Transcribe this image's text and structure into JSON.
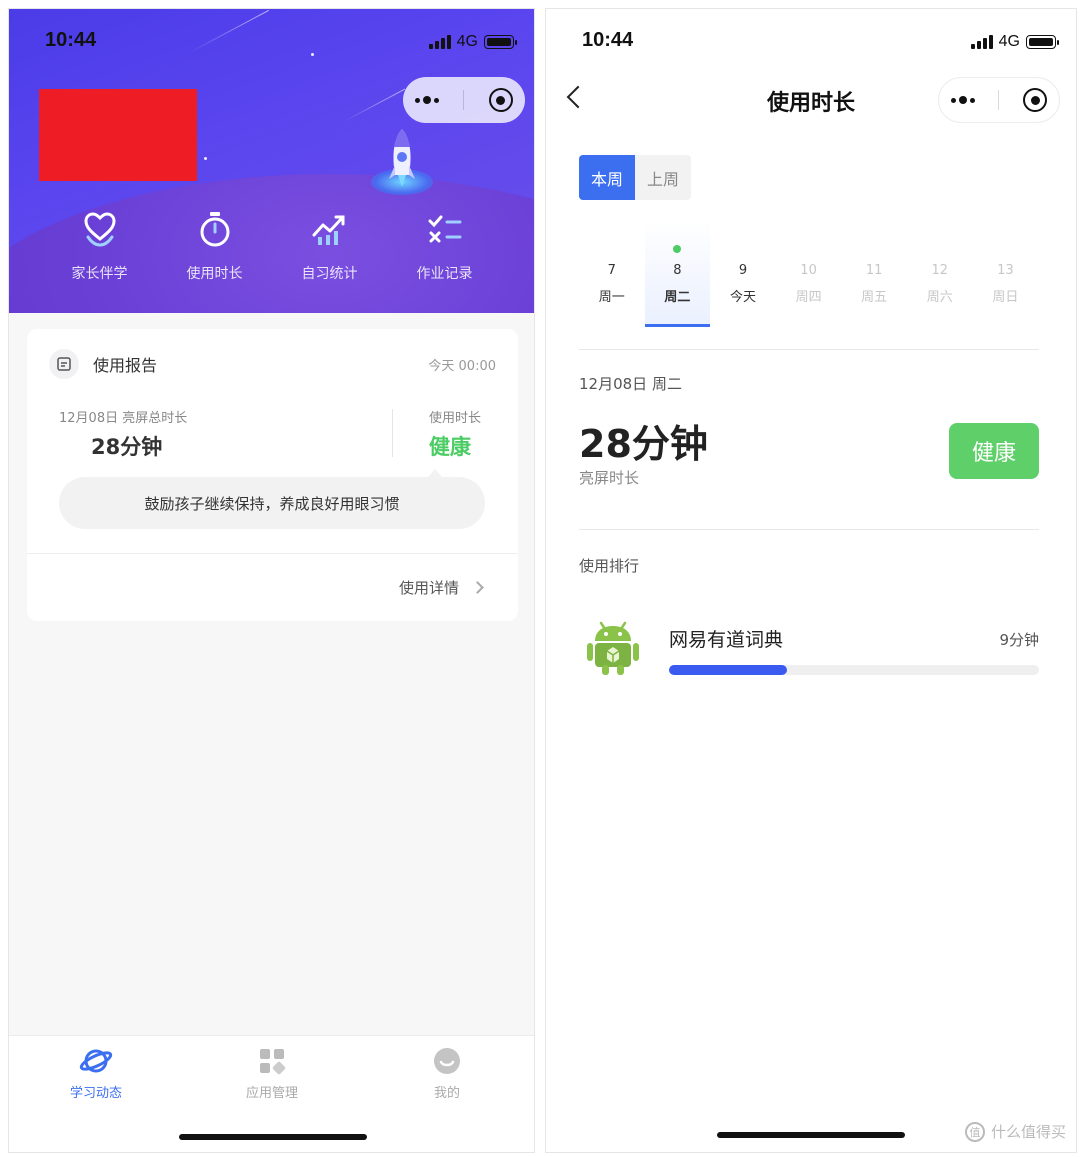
{
  "left": {
    "status": {
      "time": "10:44",
      "network": "4G"
    },
    "hero_nav": [
      {
        "label": "家长伴学",
        "icon": "heart-hand-icon"
      },
      {
        "label": "使用时长",
        "icon": "stopwatch-icon"
      },
      {
        "label": "自习统计",
        "icon": "trend-chart-icon"
      },
      {
        "label": "作业记录",
        "icon": "checklist-icon"
      }
    ],
    "report": {
      "title": "使用报告",
      "time": "今天 00:00",
      "date_label": "12月08日 亮屏总时长",
      "total": "28分钟",
      "usage_label": "使用时长",
      "usage_status": "健康",
      "tip": "鼓励孩子继续保持，养成良好用眼习惯",
      "detail_link": "使用详情"
    },
    "tabbar": [
      {
        "label": "学习动态",
        "icon": "planet-icon",
        "active": true
      },
      {
        "label": "应用管理",
        "icon": "apps-grid-icon",
        "active": false
      },
      {
        "label": "我的",
        "icon": "profile-icon",
        "active": false
      }
    ]
  },
  "right": {
    "status": {
      "time": "10:44",
      "network": "4G"
    },
    "title": "使用时长",
    "week_tabs": [
      "本周",
      "上周"
    ],
    "days": [
      {
        "num": "7",
        "label": "周一",
        "state": "past"
      },
      {
        "num": "8",
        "label": "周二",
        "state": "selected"
      },
      {
        "num": "9",
        "label": "今天",
        "state": "past"
      },
      {
        "num": "10",
        "label": "周四",
        "state": "future"
      },
      {
        "num": "11",
        "label": "周五",
        "state": "future"
      },
      {
        "num": "12",
        "label": "周六",
        "state": "future"
      },
      {
        "num": "13",
        "label": "周日",
        "state": "future"
      }
    ],
    "date": "12月08日 周二",
    "total": "28分钟",
    "total_caption": "亮屏时长",
    "health": "健康",
    "rank_title": "使用排行",
    "apps": [
      {
        "name": "网易有道词典",
        "time": "9分钟",
        "share": 0.32,
        "icon": "android-icon"
      }
    ]
  },
  "watermark": "什么值得买",
  "colors": {
    "accent": "#3b6ff0",
    "healthy": "#4ccc64",
    "hero": "#5a45ef",
    "redaction": "#ee1c25"
  }
}
